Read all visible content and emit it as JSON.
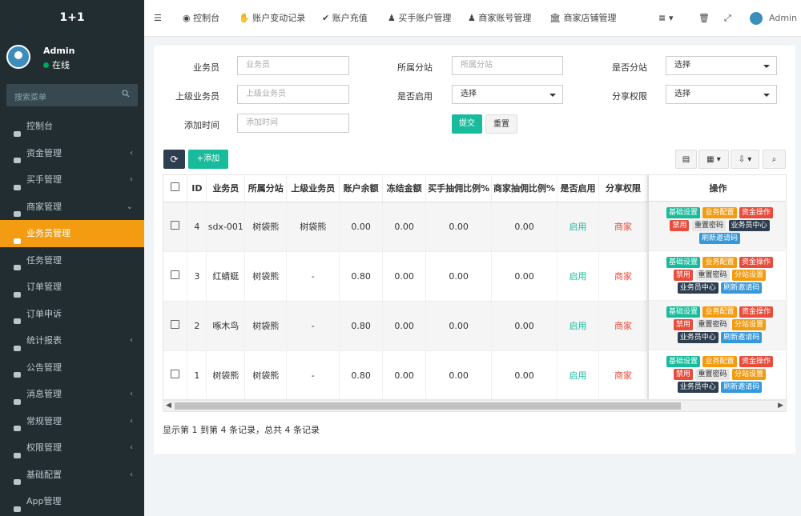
{
  "app": {
    "title": "1+1"
  },
  "user": {
    "name": "Admin",
    "status": "在线"
  },
  "sidebar": {
    "search_placeholder": "搜索菜单",
    "items": [
      {
        "label": "控制台",
        "icon": "dashboard-icon",
        "arrow": ""
      },
      {
        "label": "资金管理",
        "icon": "money-icon",
        "arrow": "‹"
      },
      {
        "label": "买手管理",
        "icon": "user-circle-icon",
        "arrow": "‹"
      },
      {
        "label": "商家管理",
        "icon": "user-icon",
        "arrow": "⌄"
      },
      {
        "label": "业务员管理",
        "icon": "hat-icon",
        "arrow": ""
      },
      {
        "label": "任务管理",
        "icon": "list-icon",
        "arrow": ""
      },
      {
        "label": "订单管理",
        "icon": "circle-icon",
        "arrow": ""
      },
      {
        "label": "订单申诉",
        "icon": "flag-icon",
        "arrow": ""
      },
      {
        "label": "统计报表",
        "icon": "database-icon",
        "arrow": "‹"
      },
      {
        "label": "公告管理",
        "icon": "send-icon",
        "arrow": ""
      },
      {
        "label": "消息管理",
        "icon": "bullhorn-icon",
        "arrow": "‹"
      },
      {
        "label": "常规管理",
        "icon": "settings-circle-icon",
        "arrow": "‹"
      },
      {
        "label": "权限管理",
        "icon": "group-icon",
        "arrow": "‹"
      },
      {
        "label": "基础配置",
        "icon": "cogs-icon",
        "arrow": "‹"
      },
      {
        "label": "App管理",
        "icon": "apple-icon",
        "arrow": ""
      }
    ]
  },
  "topbar": {
    "tabs": [
      "控制台",
      "账户变动记录",
      "账户充值",
      "买手账户管理",
      "商家账号管理",
      "商家店铺管理"
    ],
    "admin": "Admin"
  },
  "filters": {
    "salesman_label": "业务员",
    "salesman_ph": "业务员",
    "branch_label": "所属分站",
    "branch_ph": "所属分站",
    "is_branch_label": "是否分站",
    "is_branch_value": "选择",
    "parent_label": "上级业务员",
    "parent_ph": "上级业务员",
    "enabled_label": "是否启用",
    "enabled_value": "选择",
    "share_label": "分享权限",
    "share_value": "选择",
    "time_label": "添加时间",
    "time_ph": "添加时间",
    "submit": "提交",
    "reset": "重置"
  },
  "toolbar": {
    "add": "+添加"
  },
  "table": {
    "headers": [
      "ID",
      "业务员",
      "所属分站",
      "上级业务员",
      "账户余额",
      "冻结金额",
      "买手抽佣比例%",
      "商家抽佣比例%",
      "是否启用",
      "分享权限"
    ],
    "ops_header": "操作",
    "rows": [
      {
        "id": "4",
        "name": "sdx-001",
        "branch": "树袋熊",
        "parent": "树袋熊",
        "balance": "0.00",
        "frozen": "0.00",
        "buyer_rate": "0.00",
        "seller_rate": "0.00",
        "enabled": "启用",
        "share": "商家"
      },
      {
        "id": "3",
        "name": "红蜻蜓",
        "branch": "树袋熊",
        "parent": "-",
        "balance": "0.80",
        "frozen": "0.00",
        "buyer_rate": "0.00",
        "seller_rate": "0.00",
        "enabled": "启用",
        "share": "商家"
      },
      {
        "id": "2",
        "name": "啄木鸟",
        "branch": "树袋熊",
        "parent": "-",
        "balance": "0.80",
        "frozen": "0.00",
        "buyer_rate": "0.00",
        "seller_rate": "0.00",
        "enabled": "启用",
        "share": "商家"
      },
      {
        "id": "1",
        "name": "树袋熊",
        "branch": "树袋熊",
        "parent": "-",
        "balance": "0.80",
        "frozen": "0.00",
        "buyer_rate": "0.00",
        "seller_rate": "0.00",
        "enabled": "启用",
        "share": "商家"
      }
    ],
    "ops": {
      "basic": "基础设置",
      "biz": "业务配置",
      "fund": "资金操作",
      "disable": "禁用",
      "reset_pwd": "重置密码",
      "center": "业务员中心",
      "refresh": "刷新邀请码",
      "branch_set": "分站设置"
    }
  },
  "footer": {
    "summary": "显示第 1 到第 4 条记录，总共 4 条记录"
  }
}
